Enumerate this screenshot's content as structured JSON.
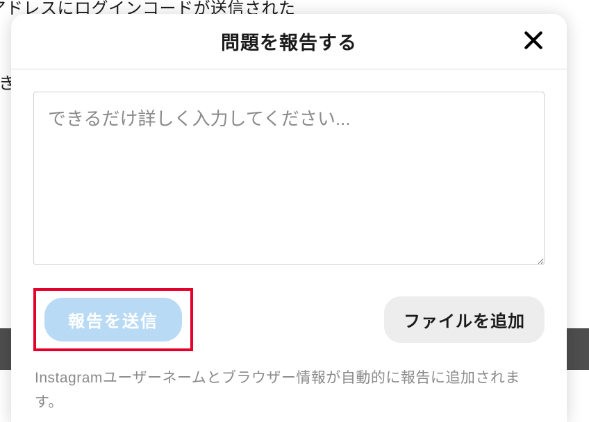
{
  "background": {
    "line1": "ルアドレスにログインコードが送信された",
    "line2": "き"
  },
  "modal": {
    "title": "問題を報告する",
    "textarea_placeholder": "できるだけ詳しく入力してください...",
    "submit_label": "報告を送信",
    "add_file_label": "ファイルを追加",
    "disclaimer": "Instagramユーザーネームとブラウザー情報が自動的に報告に追加されます。"
  }
}
